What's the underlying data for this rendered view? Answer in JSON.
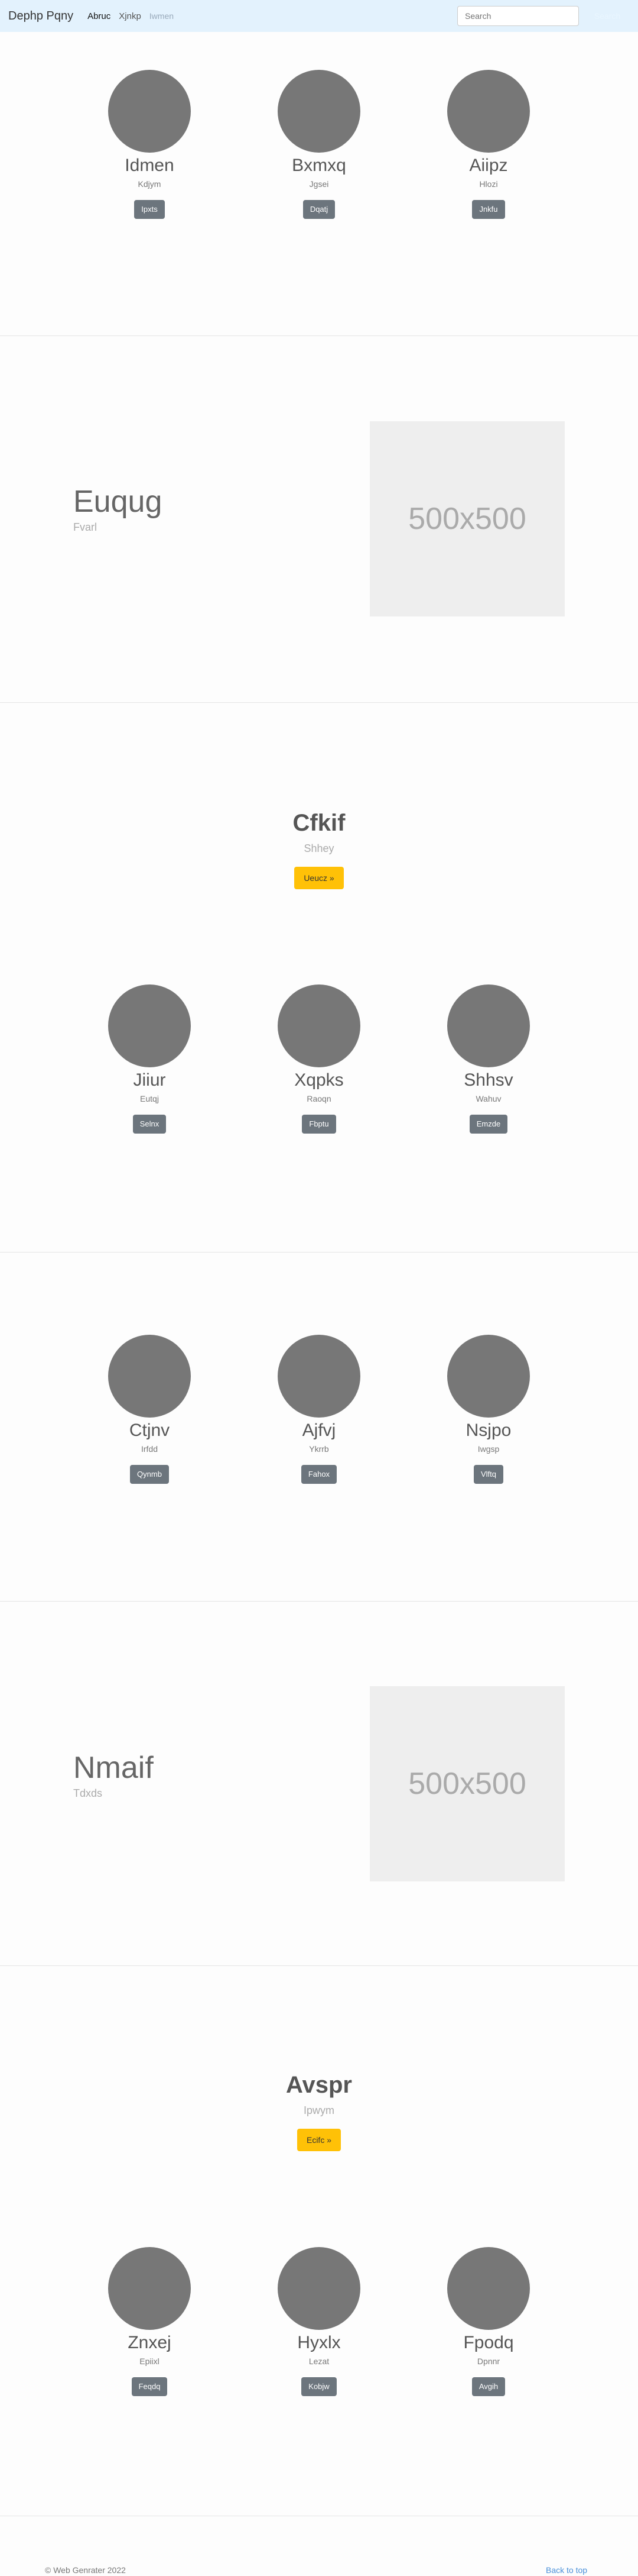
{
  "navbar": {
    "brand": "Dephp Pqny",
    "links": [
      "Abruc",
      "Xjnkp",
      "Iwmen"
    ],
    "search_placeholder": "Search",
    "search_button": "Search"
  },
  "heads1": [
    {
      "name": "Idmen",
      "sub": "Kdjym",
      "button": "Ipxts"
    },
    {
      "name": "Bxmxq",
      "sub": "Jgsei",
      "button": "Dqatj"
    },
    {
      "name": "Aiipz",
      "sub": "Hlozi",
      "button": "Jnkfu"
    }
  ],
  "feature1": {
    "title": "Euqug",
    "subtitle": "Fvarl",
    "image_text": "500x500"
  },
  "jumbo1": {
    "title": "Cfkif",
    "subtitle": "Shhey",
    "button": "Ueucz »"
  },
  "heads2": [
    {
      "name": "Jiiur",
      "sub": "Eutqj",
      "button": "Selnx"
    },
    {
      "name": "Xqpks",
      "sub": "Raoqn",
      "button": "Fbptu"
    },
    {
      "name": "Shhsv",
      "sub": "Wahuv",
      "button": "Emzde"
    }
  ],
  "heads3": [
    {
      "name": "Ctjnv",
      "sub": "Irfdd",
      "button": "Qynmb"
    },
    {
      "name": "Ajfvj",
      "sub": "Ykrrb",
      "button": "Fahox"
    },
    {
      "name": "Nsjpo",
      "sub": "Iwgsp",
      "button": "Vlftq"
    }
  ],
  "feature2": {
    "title": "Nmaif",
    "subtitle": "Tdxds",
    "image_text": "500x500"
  },
  "jumbo2": {
    "title": "Avspr",
    "subtitle": "Ipwym",
    "button": "Ecifc »"
  },
  "heads4": [
    {
      "name": "Znxej",
      "sub": "Epiixl",
      "button": "Feqdq"
    },
    {
      "name": "Hyxlx",
      "sub": "Lezat",
      "button": "Kobjw"
    },
    {
      "name": "Fpodq",
      "sub": "Dpnnr",
      "button": "Avgih"
    }
  ],
  "footer": {
    "copyright": "© Web Genrater 2022",
    "back_to_top": "Back to top"
  }
}
